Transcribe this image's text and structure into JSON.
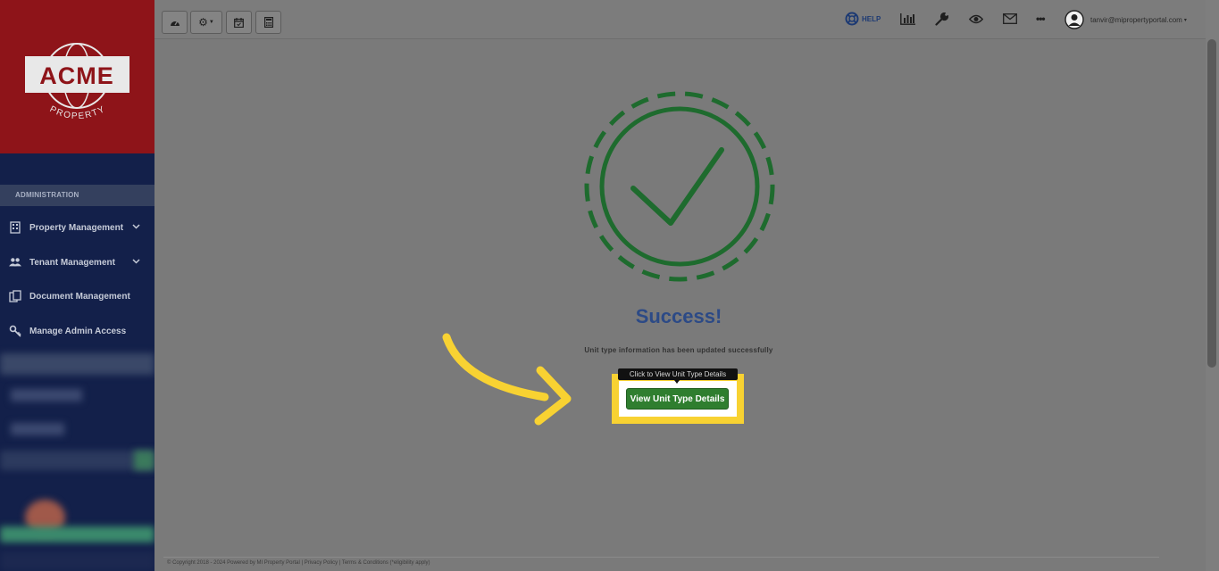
{
  "sidebar": {
    "logo": {
      "brand": "ACME",
      "sub": "PROPERTY"
    },
    "section_header": "ADMINISTRATION",
    "items": [
      {
        "label": "Property Management",
        "icon": "building-icon",
        "has_submenu": true
      },
      {
        "label": "Tenant Management",
        "icon": "users-icon",
        "has_submenu": true
      },
      {
        "label": "Document Management",
        "icon": "documents-icon",
        "has_submenu": false
      },
      {
        "label": "Manage Admin Access",
        "icon": "key-icon",
        "has_submenu": false
      }
    ]
  },
  "topbar": {
    "tools": [
      "dashboard-icon",
      "settings-icon",
      "calendar-icon",
      "calculator-icon"
    ],
    "help_label": "HELP",
    "user_email": "tanvir@mipropertyportal.com"
  },
  "main": {
    "success_title": "Success!",
    "success_message": "Unit type information has been updated successfully",
    "tooltip": "Click to View Unit Type Details",
    "view_button_label": "View Unit Type Details"
  },
  "footer": {
    "text": "© Copyright 2018 - 2024 Powered by MI Property Portal | Privacy Policy | Terms & Conditions (*eligibility apply)"
  },
  "colors": {
    "sidebar_bg": "#13204a",
    "logo_bg": "#8e1419",
    "success_green": "#1e6b2e",
    "button_green": "#2f7e2f",
    "title_blue": "#2c4a86",
    "highlight_yellow": "#f8d232"
  }
}
